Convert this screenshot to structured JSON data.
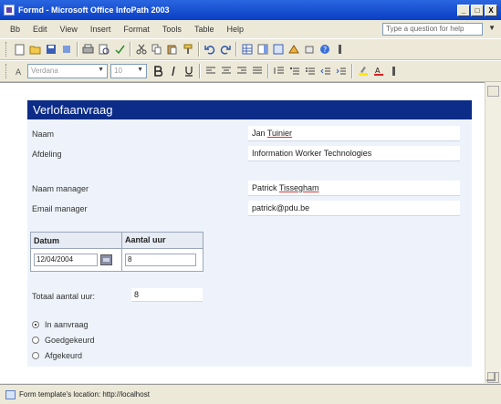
{
  "window": {
    "title": "Formd - Microsoft Office InfoPath 2003",
    "controls": [
      "_",
      "□",
      "X"
    ]
  },
  "menu": {
    "items": [
      "Bb",
      "Edit",
      "View",
      "Insert",
      "Format",
      "Tools",
      "Table",
      "Help"
    ],
    "help_placeholder": "Type a question for help"
  },
  "toolbar": {
    "font_name": "Verdana",
    "font_size": "10"
  },
  "form": {
    "title": "Verlofaanvraag",
    "labels": {
      "naam": "Naam",
      "afdeling": "Afdeling",
      "naam_manager": "Naam manager",
      "email_manager": "Email manager",
      "totaal": "Totaal aantal uur:"
    },
    "values": {
      "naam_first": "Jan",
      "naam_last": "Tuinier",
      "afdeling": "Information Worker Technologies",
      "manager_first": "Patrick",
      "manager_last": "Tissegham",
      "email": "patrick@pdu.be",
      "totaal": "8"
    },
    "table": {
      "headers": [
        "Datum",
        "Aantal uur"
      ],
      "date_value": "12/04/2004",
      "hours_value": "8"
    },
    "status_options": [
      {
        "label": "In aanvraag",
        "selected": true
      },
      {
        "label": "Goedgekeurd",
        "selected": false
      },
      {
        "label": "Afgekeurd",
        "selected": false
      }
    ]
  },
  "statusbar": {
    "text": "Form template's location: http://localhost"
  }
}
